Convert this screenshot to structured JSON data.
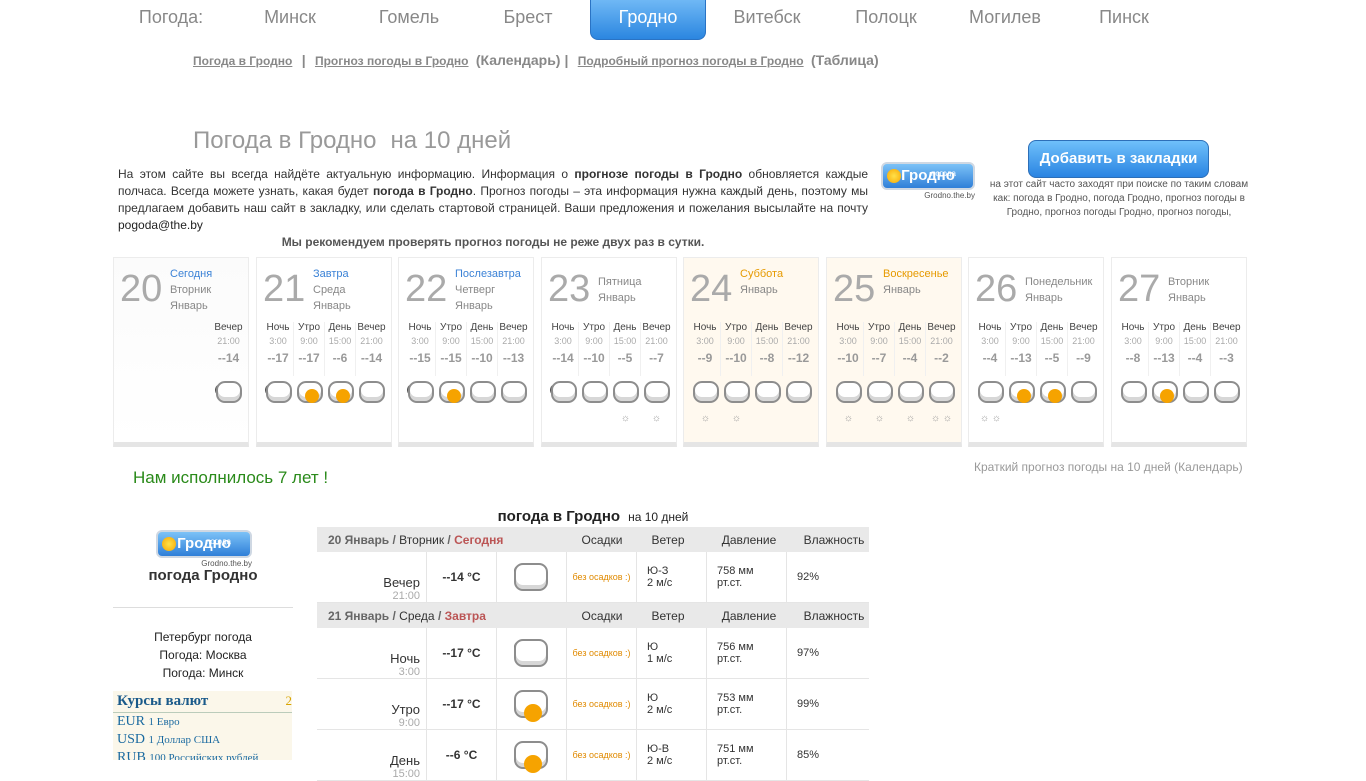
{
  "city_nav": {
    "label": "Погода:",
    "cities": [
      "Минск",
      "Гомель",
      "Брест",
      "Гродно",
      "Витебск",
      "Полоцк",
      "Могилев",
      "Пинск"
    ],
    "active": "Гродно"
  },
  "sublinks": {
    "link1": "Погода в Гродно",
    "sep1": "|",
    "link2": "Прогноз погоды в Гродно",
    "paren2": "(Календарь)",
    "sep2": "|",
    "link3": "Подробный прогноз погоды в Гродно",
    "paren3": "(Таблица)"
  },
  "heading": {
    "title": "Погода в Гродно",
    "suffix": "на 10 дней"
  },
  "intro": {
    "t1": "На этом сайте вы всегда найдёте актуальную информацию. Информация о ",
    "b1": "прогнозе погоды в Гродно",
    "t2": " обновляется каждые полчаса. Всегда можете узнать, какая будет ",
    "b2": "погода в Гродно",
    "t3": ". Прогноз погоды – эта информация нужна каждый день, поэтому мы предлагаем добавить наш сайт в закладку, или сделать стартовой страницей. Ваши предложения и пожелания высылайте на почту ",
    "email": "pogoda@the.by",
    "recommend": "Мы рекомендуем проверять прогноз погоды не реже двух раз в сутки."
  },
  "logo": {
    "small_text": "погода",
    "name": "Гродно",
    "url": "Grodno.the.by"
  },
  "bookmark": {
    "button": "Добавить в закладки",
    "note": "на этот сайт часто заходят при поиске по таким словам как: погода в Гродно, погода Гродно, прогноз погоды в Гродно, прогноз погоды Гродно, прогноз погоды,"
  },
  "days": [
    {
      "num": "20",
      "label": "Сегодня",
      "weekday": "Вторник",
      "month": "Январь",
      "periods": [
        {
          "name": "Вечер",
          "time": "21:00",
          "temp": "--14",
          "icon": "night-cloud-icon",
          "snow": ""
        }
      ]
    },
    {
      "num": "21",
      "label": "Завтра",
      "weekday": "Среда",
      "month": "Январь",
      "periods": [
        {
          "name": "Ночь",
          "time": "3:00",
          "temp": "--17",
          "icon": "night-cloud-icon",
          "snow": ""
        },
        {
          "name": "Утро",
          "time": "9:00",
          "temp": "--17",
          "icon": "sun-cloud-icon",
          "snow": ""
        },
        {
          "name": "День",
          "time": "15:00",
          "temp": "--6",
          "icon": "sun-cloud-icon",
          "snow": ""
        },
        {
          "name": "Вечер",
          "time": "21:00",
          "temp": "--14",
          "icon": "cloud-icon",
          "snow": ""
        }
      ]
    },
    {
      "num": "22",
      "label": "Послезавтра",
      "weekday": "Четверг",
      "month": "Январь",
      "periods": [
        {
          "name": "Ночь",
          "time": "3:00",
          "temp": "--15",
          "icon": "night-cloud-icon",
          "snow": ""
        },
        {
          "name": "Утро",
          "time": "9:00",
          "temp": "--15",
          "icon": "sun-cloud-icon",
          "snow": ""
        },
        {
          "name": "День",
          "time": "15:00",
          "temp": "--10",
          "icon": "cloud-icon",
          "snow": ""
        },
        {
          "name": "Вечер",
          "time": "21:00",
          "temp": "--13",
          "icon": "cloud-icon",
          "snow": ""
        }
      ]
    },
    {
      "num": "23",
      "label": "",
      "weekday": "Пятница",
      "month": "Январь",
      "periods": [
        {
          "name": "Ночь",
          "time": "3:00",
          "temp": "--14",
          "icon": "night-cloud-icon",
          "snow": ""
        },
        {
          "name": "Утро",
          "time": "9:00",
          "temp": "--10",
          "icon": "cloud-icon",
          "snow": ""
        },
        {
          "name": "День",
          "time": "15:00",
          "temp": "--5",
          "icon": "cloud-icon",
          "snow": "☼"
        },
        {
          "name": "Вечер",
          "time": "21:00",
          "temp": "--7",
          "icon": "cloud-icon",
          "snow": "☼"
        }
      ]
    },
    {
      "num": "24",
      "label": "Суббота",
      "weekday": "",
      "month": "Январь",
      "weekend": true,
      "periods": [
        {
          "name": "Ночь",
          "time": "3:00",
          "temp": "--9",
          "icon": "cloud-icon",
          "snow": "☼"
        },
        {
          "name": "Утро",
          "time": "9:00",
          "temp": "--10",
          "icon": "cloud-icon",
          "snow": "☼"
        },
        {
          "name": "День",
          "time": "15:00",
          "temp": "--8",
          "icon": "cloud-icon",
          "snow": ""
        },
        {
          "name": "Вечер",
          "time": "21:00",
          "temp": "--12",
          "icon": "cloud-icon",
          "snow": ""
        }
      ]
    },
    {
      "num": "25",
      "label": "Воскресенье",
      "weekday": "",
      "month": "Январь",
      "weekend": true,
      "periods": [
        {
          "name": "Ночь",
          "time": "3:00",
          "temp": "--10",
          "icon": "cloud-icon",
          "snow": "☼"
        },
        {
          "name": "Утро",
          "time": "9:00",
          "temp": "--7",
          "icon": "cloud-icon",
          "snow": "☼"
        },
        {
          "name": "День",
          "time": "15:00",
          "temp": "--4",
          "icon": "cloud-icon",
          "snow": "☼"
        },
        {
          "name": "Вечер",
          "time": "21:00",
          "temp": "--2",
          "icon": "cloud-icon",
          "snow": "☼ ☼"
        }
      ]
    },
    {
      "num": "26",
      "label": "",
      "weekday": "Понедельник",
      "month": "Январь",
      "periods": [
        {
          "name": "Ночь",
          "time": "3:00",
          "temp": "--4",
          "icon": "cloud-icon",
          "snow": "☼ ☼"
        },
        {
          "name": "Утро",
          "time": "9:00",
          "temp": "--13",
          "icon": "sun-cloud-icon",
          "snow": ""
        },
        {
          "name": "День",
          "time": "15:00",
          "temp": "--5",
          "icon": "sun-cloud-icon",
          "snow": ""
        },
        {
          "name": "Вечер",
          "time": "21:00",
          "temp": "--9",
          "icon": "cloud-icon",
          "snow": ""
        }
      ]
    },
    {
      "num": "27",
      "label": "",
      "weekday": "Вторник",
      "month": "Январь",
      "periods": [
        {
          "name": "Ночь",
          "time": "3:00",
          "temp": "--8",
          "icon": "cloud-icon",
          "snow": ""
        },
        {
          "name": "Утро",
          "time": "9:00",
          "temp": "--13",
          "icon": "sun-cloud-icon",
          "snow": ""
        },
        {
          "name": "День",
          "time": "15:00",
          "temp": "--4",
          "icon": "cloud-icon",
          "snow": ""
        },
        {
          "name": "Вечер",
          "time": "21:00",
          "temp": "--3",
          "icon": "cloud-icon",
          "snow": ""
        }
      ]
    }
  ],
  "short_link": "Краткий прогноз погоды на 10 дней (Календарь)",
  "anniversary": "Нам исполнилось 7 лет !",
  "left": {
    "title": "погода Гродно",
    "links": [
      "Петербург погода",
      "Погода: Москва",
      "Погода: Минск"
    ],
    "rates_title": "Курсы валют",
    "rates_num": "2",
    "rates": [
      {
        "code": "EUR",
        "desc": "1 Евро"
      },
      {
        "code": "USD",
        "desc": "1 Доллар США"
      },
      {
        "code": "RUB",
        "desc": "100 Российских рублей"
      }
    ]
  },
  "table": {
    "title": "погода в Гродно",
    "title_suffix": "на 10 дней",
    "col_precip": "Осадки",
    "col_wind": "Ветер",
    "col_pressure": "Давление",
    "col_humidity": "Влажность",
    "groups": [
      {
        "date": "20 Январь /",
        "weekday": "Вторник",
        "slash": "/",
        "label": "Сегодня",
        "rows": [
          {
            "period": "Вечер",
            "time": "21:00",
            "temp": "--14 °C",
            "icon": "night-cloud-icon",
            "precip": "без осадков :)",
            "wind_dir": "Ю-З",
            "wind_speed": "2 м/с",
            "pressure": "758 мм",
            "pressure_unit": "рт.ст.",
            "humidity": "92%"
          }
        ]
      },
      {
        "date": "21 Январь /",
        "weekday": "Среда",
        "slash": "/",
        "label": "Завтра",
        "rows": [
          {
            "period": "Ночь",
            "time": "3:00",
            "temp": "--17 °C",
            "icon": "night-cloud-icon",
            "precip": "без осадков :)",
            "wind_dir": "Ю",
            "wind_speed": "1 м/с",
            "pressure": "756 мм",
            "pressure_unit": "рт.ст.",
            "humidity": "97%"
          },
          {
            "period": "Утро",
            "time": "9:00",
            "temp": "--17 °C",
            "icon": "sun-cloud-icon",
            "precip": "без осадков :)",
            "wind_dir": "Ю",
            "wind_speed": "2 м/с",
            "pressure": "753 мм",
            "pressure_unit": "рт.ст.",
            "humidity": "99%"
          },
          {
            "period": "День",
            "time": "15:00",
            "temp": "--6 °C",
            "icon": "sun-cloud-icon",
            "precip": "без осадков :)",
            "wind_dir": "Ю-В",
            "wind_speed": "2 м/с",
            "pressure": "751 мм",
            "pressure_unit": "рт.ст.",
            "humidity": "85%"
          }
        ]
      }
    ]
  }
}
